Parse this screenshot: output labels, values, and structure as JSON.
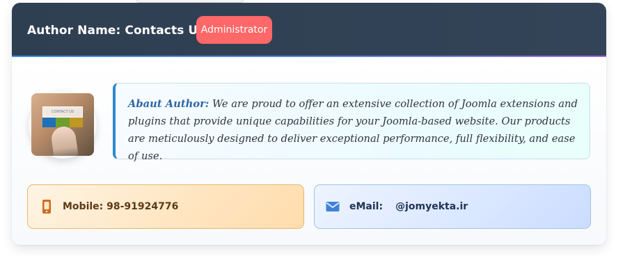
{
  "header": {
    "author_title": "Author Name: Contacts US",
    "role_badge": "Administrator"
  },
  "avatar": {
    "board_text": "CONTACT US",
    "icons": [
      "phone-icon",
      "mail-icon",
      "chat-icon"
    ]
  },
  "about": {
    "label": "Abaut Author:",
    "text": "We are proud to offer an extensive collection of Joomla extensions and plugins that provide unique capabilities for your Joomla-based website. Our products are meticulously designed to deliver exceptional performance, full flexibility, and ease of use."
  },
  "contacts": {
    "mobile": {
      "label": "Mobile:",
      "value": "98-91924776"
    },
    "email": {
      "label": "eMail:",
      "value": "@jomyekta.ir"
    }
  },
  "colors": {
    "header_bg": "#334356",
    "badge_bg": "#ff6868",
    "about_accent": "#2d88cf",
    "mobile_accent": "#d2691e",
    "email_accent": "#3f82d6"
  }
}
